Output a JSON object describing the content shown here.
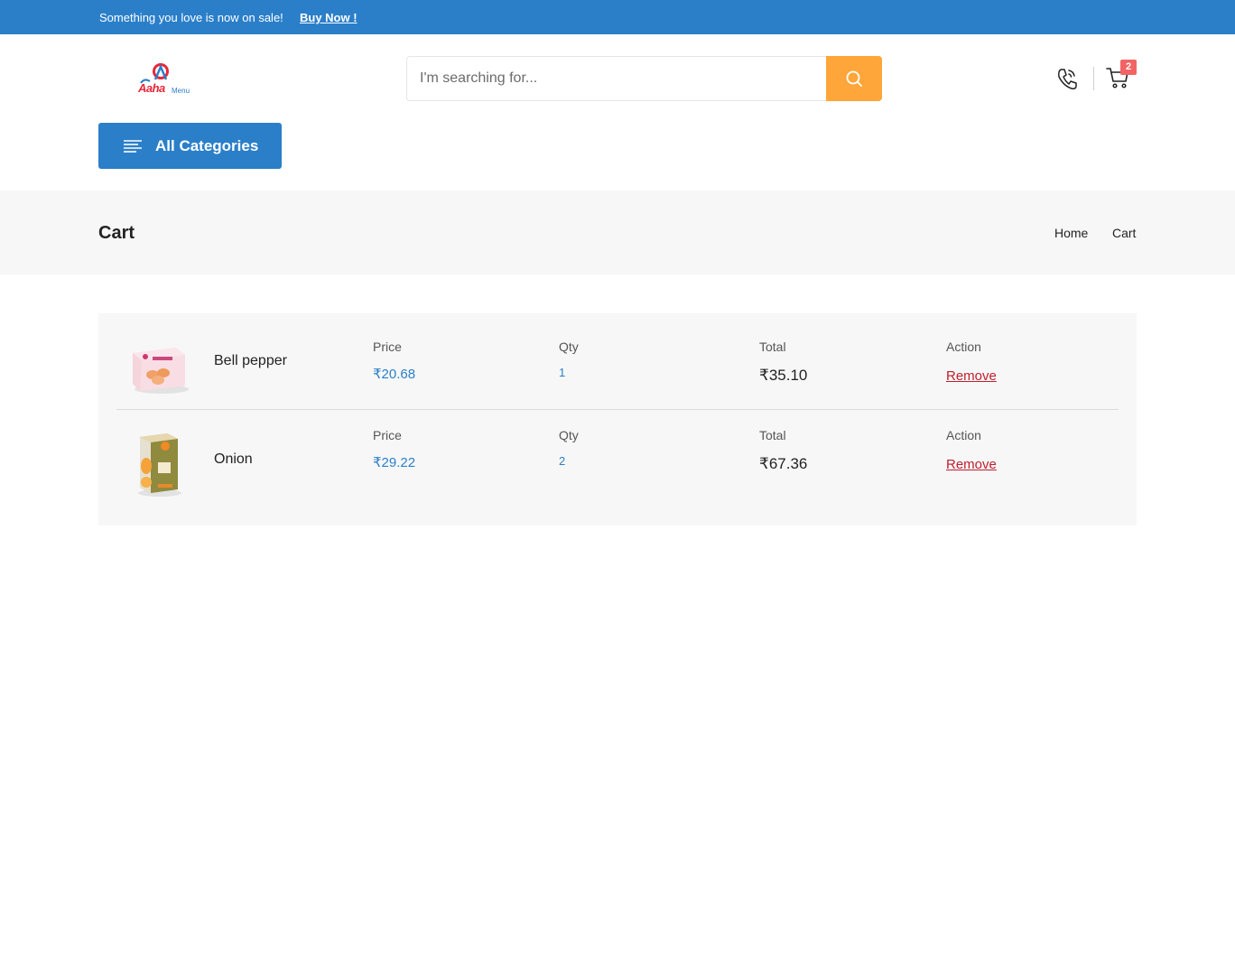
{
  "topbar": {
    "message": "Something you love is now on sale!",
    "cta": "Buy Now !",
    "background": "#2b7fc9"
  },
  "header": {
    "logo": {
      "brand": "Aaha",
      "sub": "Menu"
    },
    "search": {
      "placeholder": "I'm searching for...",
      "button_icon": "search-icon",
      "button_color": "#ffa63a"
    },
    "icons": [
      "phone-icon",
      "cart-icon"
    ],
    "cart_count": "2"
  },
  "nav": {
    "categories_label": "All Categories",
    "categories_icon": "menu-lines-icon"
  },
  "page": {
    "title": "Cart",
    "breadcrumb": [
      "Home",
      "Cart"
    ]
  },
  "cart": {
    "items": [
      {
        "name": "Bell pepper",
        "price_label": "Price",
        "price": "₹20.68",
        "qty_label": "Qty",
        "qty": "1",
        "total_label": "Total",
        "total": "₹35.10",
        "action_label": "Action",
        "action": "Remove"
      },
      {
        "name": "Onion",
        "price_label": "Price",
        "price": "₹29.22",
        "qty_label": "Qty",
        "qty": "2",
        "total_label": "Total",
        "total": "₹67.36",
        "action_label": "Action",
        "action": "Remove"
      }
    ]
  },
  "colors": {
    "accent": "#2b7fc9",
    "search_button": "#ffa63a",
    "badge": "#f26464",
    "remove_link": "#c01f2e"
  }
}
